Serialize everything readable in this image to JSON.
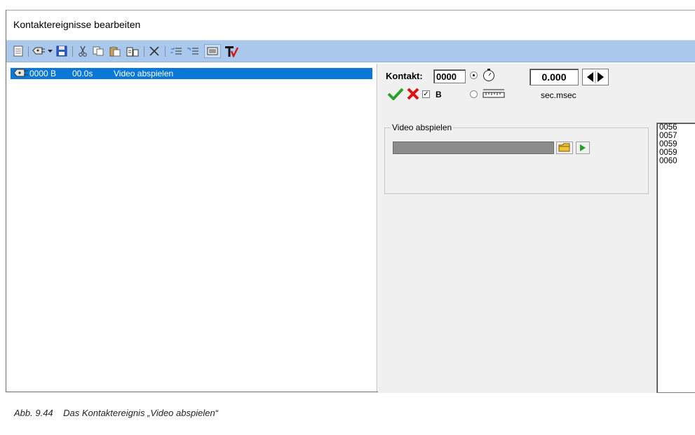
{
  "window": {
    "title": "Kontaktereignisse bearbeiten"
  },
  "toolbar": {
    "icons": [
      "new-doc-icon",
      "contact-add-icon",
      "dropdown-arrow-icon",
      "save-icon",
      "cut-icon",
      "copy-icon",
      "paste-icon",
      "paste-special-icon",
      "delete-icon",
      "indent-icon",
      "outdent-icon",
      "list-view-icon",
      "text-tool-icon"
    ]
  },
  "list": {
    "rows": [
      {
        "id": "0000 B",
        "time": "00.0s",
        "action": "Video abspielen",
        "selected": true
      }
    ]
  },
  "editor": {
    "kontakt_label": "Kontakt:",
    "kontakt_value": "0000",
    "time_value": "0.000",
    "time_unit": "sec.msec",
    "b_label": "B",
    "b_checked": true,
    "mode_timer_selected": true
  },
  "group": {
    "title": "Video abspielen"
  },
  "number_list": [
    "0056",
    "0057",
    "0059",
    "0059",
    "0060"
  ],
  "caption": {
    "fig": "Abb. 9.44",
    "text": "Das Kontaktereignis „Video abspielen“"
  },
  "colors": {
    "toolbar": "#a9c8ec",
    "selection": "#0a78d7",
    "panel": "#f0f0f0"
  }
}
